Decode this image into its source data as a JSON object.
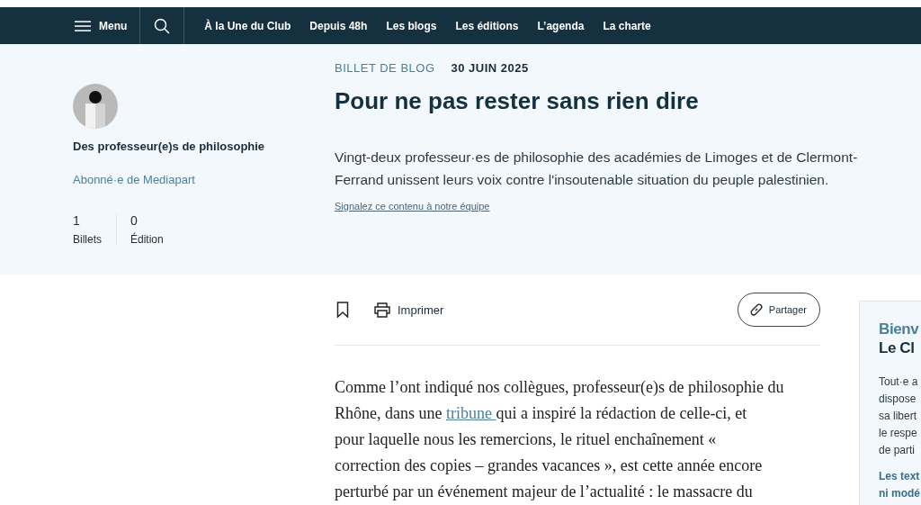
{
  "nav": {
    "menu": "Menu",
    "links": [
      "À la Une du Club",
      "Depuis 48h",
      "Les blogs",
      "Les éditions",
      "L’agenda",
      "La charte"
    ]
  },
  "author": {
    "name": "Des professeur(e)s de philosophie",
    "status": "Abonné·e de Mediapart",
    "stats": [
      {
        "value": "1",
        "label": "Billets"
      },
      {
        "value": "0",
        "label": "Édition"
      }
    ]
  },
  "post": {
    "kind_label": "BILLET DE BLOG",
    "date": "30 JUIN 2025",
    "title": "Pour ne pas rester sans rien dire",
    "lead": "Vingt-deux professeur·es de philosophie des académies de Limoges et de Clermont-Ferrand unissent leurs voix contre l'insoutenable situation du peuple palestinien.",
    "report": "Signalez ce contenu à notre équipe"
  },
  "toolbar": {
    "print": "Imprimer",
    "share": "Partager"
  },
  "body": [
    {
      "kind": "text",
      "text": "Comme l’ont indiqué nos collègues, professeur(e)s de philosophie du\nRhône, dans une "
    },
    {
      "kind": "link",
      "text": "tribune "
    },
    {
      "kind": "text",
      "text": "qui a inspiré la rédaction de celle-ci, et\npour laquelle nous les remercions, le rituel enchaînement «\ncorrection des copies – grandes vacances », est cette année encore\nperturbé par un événement majeur de l’actualité : le massacre du"
    }
  ],
  "side_card": {
    "title_lines": [
      "Bienv",
      "Le Cl"
    ],
    "text_lines": [
      "Tout·e a",
      "dispose",
      "sa libert",
      "le respe",
      "de parti"
    ],
    "bold_lines": [
      "Les text",
      "ni modé"
    ]
  }
}
